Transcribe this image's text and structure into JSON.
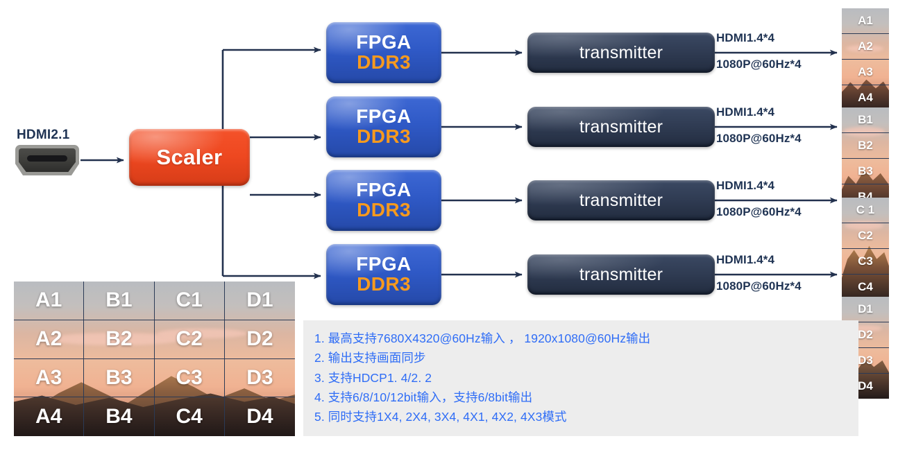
{
  "input": {
    "connector_label": "HDMI2.1",
    "connector_icon": "hdmi-port-icon"
  },
  "scaler": {
    "label": "Scaler",
    "color": "#ee4820"
  },
  "processing_chain": {
    "fpga_color": "#2f59c6",
    "fpga_accent_color": "#f79a1e",
    "transmitter_color": "#2f3b52",
    "rows": [
      {
        "fpga_top": "FPGA",
        "fpga_bottom": "DDR3",
        "transmitter": "transmitter",
        "out_line1": "HDMI1.4*4",
        "out_line2": "1080P@60Hz*4"
      },
      {
        "fpga_top": "FPGA",
        "fpga_bottom": "DDR3",
        "transmitter": "transmitter",
        "out_line1": "HDMI1.4*4",
        "out_line2": "1080P@60Hz*4"
      },
      {
        "fpga_top": "FPGA",
        "fpga_bottom": "DDR3",
        "transmitter": "transmitter",
        "out_line1": "HDMI1.4*4",
        "out_line2": "1080P@60Hz*4"
      },
      {
        "fpga_top": "FPGA",
        "fpga_bottom": "DDR3",
        "transmitter": "transmitter",
        "out_line1": "HDMI1.4*4",
        "out_line2": "1080P@60Hz*4"
      }
    ]
  },
  "output_tiles": {
    "groups": [
      {
        "name": "A",
        "labels": [
          "A1",
          "A2",
          "A3",
          "A4"
        ]
      },
      {
        "name": "B",
        "labels": [
          "B1",
          "B2",
          "B3",
          "B4"
        ]
      },
      {
        "name": "C",
        "labels": [
          "C 1",
          "C2",
          "C3",
          "C4"
        ]
      },
      {
        "name": "D",
        "labels": [
          "D1",
          "D2",
          "D3",
          "D4"
        ]
      }
    ]
  },
  "source_mosaic": {
    "cells": [
      "A1",
      "B1",
      "C1",
      "D1",
      "A2",
      "B2",
      "C2",
      "D2",
      "A3",
      "B3",
      "C3",
      "D3",
      "A4",
      "B4",
      "C4",
      "D4"
    ]
  },
  "specs": {
    "text_color": "#2f6df6",
    "background": "#ededed",
    "lines": [
      "1. 最高支持7680X4320@60Hz输入 ， 1920x1080@60Hz输出",
      "2. 输出支持画面同步",
      "3. 支持HDCP1. 4/2. 2",
      "4. 支持6/8/10/12bit输入，支持6/8bit输出",
      "5. 同时支持1X4, 2X4, 3X4, 4X1, 4X2, 4X3模式"
    ]
  }
}
